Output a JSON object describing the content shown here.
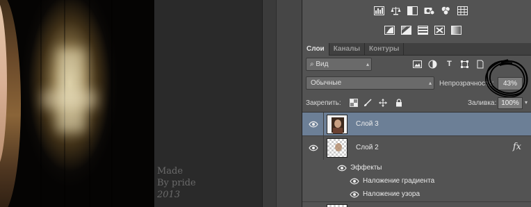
{
  "canvas": {
    "watermark": {
      "line1": "Made",
      "line2": "By pride",
      "year": "2013"
    }
  },
  "adjustments": {
    "row1": [
      "levels-icon",
      "balance-icon",
      "bw-icon",
      "photo-filter-icon",
      "channel-mixer-icon",
      "color-lookup-icon"
    ],
    "row2": [
      "invert-icon",
      "posterize-icon",
      "threshold-icon",
      "selective-color-icon",
      "gradient-map-icon"
    ]
  },
  "tabs": [
    {
      "label": "Слои",
      "active": true
    },
    {
      "label": "Каналы",
      "active": false
    },
    {
      "label": "Контуры",
      "active": false
    }
  ],
  "filter": {
    "kind_value": "Вид",
    "icons": [
      "image-filter-icon",
      "adjustment-filter-icon",
      "type-filter-icon",
      "shape-filter-icon",
      "smart-object-filter-icon"
    ]
  },
  "blend": {
    "mode_value": "Обычные",
    "opacity_label": "Непрозрачность:",
    "opacity_value": "43%"
  },
  "lock": {
    "label": "Закрепить:",
    "fill_label": "Заливка:",
    "fill_value": "100%"
  },
  "layers": [
    {
      "name": "Слой 3",
      "selected": true,
      "visible": true,
      "fx": ""
    },
    {
      "name": "Слой 2",
      "selected": false,
      "visible": true,
      "fx": "fx",
      "effects_label": "Эффекты",
      "effects": [
        "Наложение градиента",
        "Наложение узора"
      ]
    }
  ],
  "colors": {
    "panel": "#535353",
    "selected_layer": "#6c7f96",
    "tab_bar": "#404040"
  }
}
